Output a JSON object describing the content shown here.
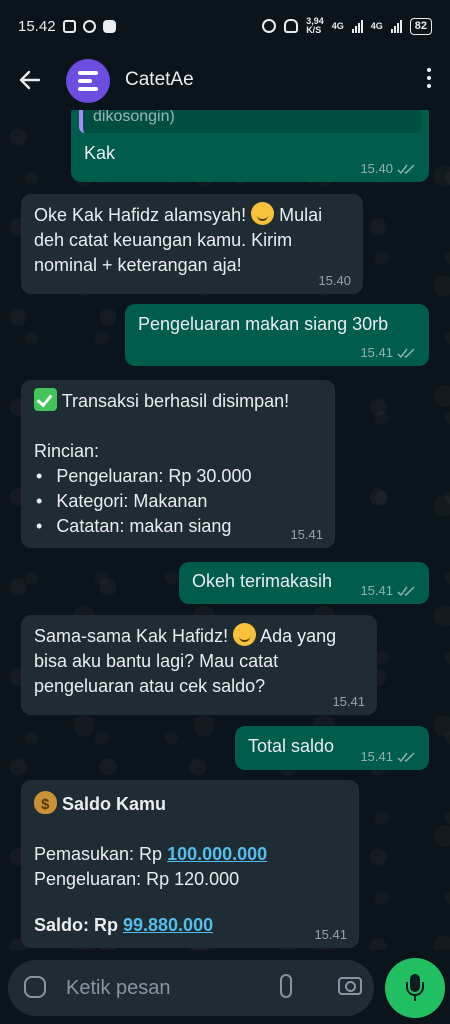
{
  "status_bar": {
    "time": "15.42",
    "net_speed_value": "3,94",
    "net_speed_unit": "K/S",
    "net_1": "4G",
    "net_2": "4G",
    "battery": "82"
  },
  "header": {
    "title": "CatetAe"
  },
  "messages": {
    "m1": {
      "quote": "dikosongin)",
      "text": "Kak",
      "time": "15.40"
    },
    "m2": {
      "text": "Oke Kak Hafidz alamsyah! ",
      "text2": " Mulai deh catat keuangan kamu. Kirim nominal + keterangan aja!",
      "time": "15.40"
    },
    "m3": {
      "text": "Pengeluaran makan siang 30rb",
      "time": "15.41"
    },
    "m4": {
      "title": "Transaksi berhasil disimpan!",
      "subtitle": "Rincian:",
      "items": [
        "Pengeluaran: Rp 30.000",
        "Kategori: Makanan",
        "Catatan: makan siang"
      ],
      "time": "15.41"
    },
    "m5": {
      "text": "Okeh terimakasih",
      "time": "15.41"
    },
    "m6": {
      "text": "Sama-sama Kak Hafidz! ",
      "text2": " Ada yang bisa aku bantu lagi? Mau catat pengeluaran atau cek saldo?",
      "time": "15.41"
    },
    "m7": {
      "text": "Total saldo",
      "time": "15.41"
    },
    "m8": {
      "title": "Saldo Kamu",
      "income_label": "Pemasukan: Rp ",
      "income_value": "100.000.000",
      "expense_label": "Pengeluaran: Rp 120.000",
      "balance_label": "Saldo: Rp ",
      "balance_value": "99.880.000",
      "time": "15.41"
    }
  },
  "input": {
    "placeholder": "Ketik pesan"
  },
  "colors": {
    "background": "#0b141a",
    "incoming": "#202c33",
    "outgoing": "#005c4b",
    "accent": "#21c063",
    "link": "#53bdeb"
  }
}
